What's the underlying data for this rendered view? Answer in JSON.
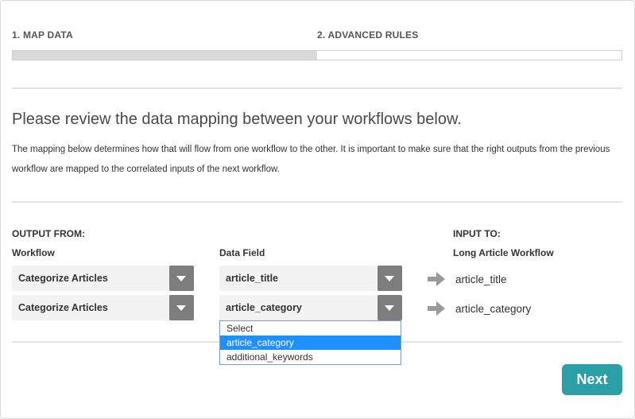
{
  "steps": [
    {
      "label": "1. MAP DATA"
    },
    {
      "label": "2. ADVANCED RULES"
    }
  ],
  "progress": {
    "fraction": 0.5
  },
  "heading": "Please review the data mapping between your workflows below.",
  "description": "The mapping below determines how that will flow from one workflow to the other. It is important to make sure that the right outputs from the previous workflow are mapped to the correlated inputs of the next workflow.",
  "columns": {
    "output_from": "OUTPUT FROM:",
    "workflow": "Workflow",
    "data_field": "Data Field",
    "input_to": "INPUT TO:",
    "target_workflow": "Long Article Workflow"
  },
  "rows": [
    {
      "workflow": "Categorize Articles",
      "field": "article_title",
      "input": "article_title"
    },
    {
      "workflow": "Categorize Articles",
      "field": "article_category",
      "input": "article_category"
    }
  ],
  "dropdown": {
    "options": [
      "Select",
      "article_category",
      "additional_keywords"
    ],
    "selected_index": 1
  },
  "next_label": "Next",
  "colors": {
    "accent": "#2aa0a6",
    "selected": "#1e90ff",
    "select_button": "#7d7d7d"
  }
}
